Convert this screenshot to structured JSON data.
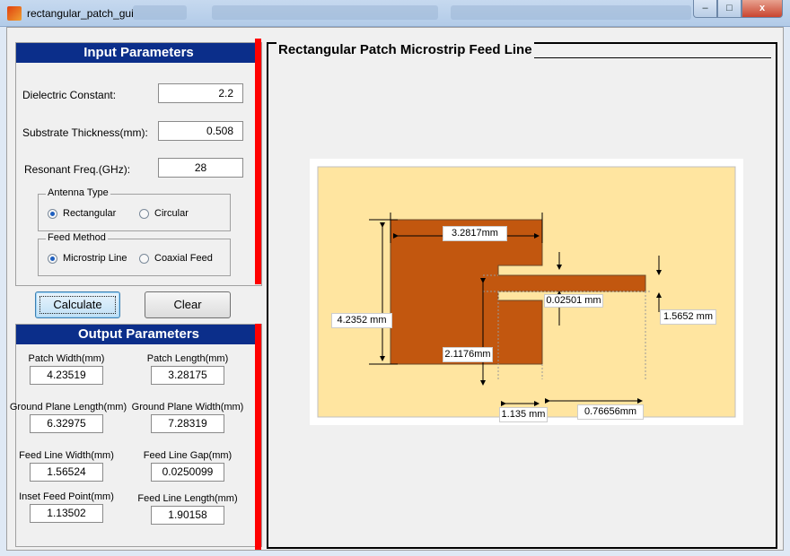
{
  "window": {
    "title": "rectangular_patch_gui",
    "minimize": "–",
    "maximize": "□",
    "close": "x"
  },
  "input": {
    "title": "Input Parameters",
    "dielectric_label": "Dielectric Constant:",
    "dielectric_value": "2.2",
    "thickness_label": "Substrate Thickness(mm):",
    "thickness_value": "0.508",
    "freq_label": "Resonant Freq.(GHz):",
    "freq_value": "28",
    "antenna_type": {
      "title": "Antenna Type",
      "options": [
        "Rectangular",
        "Circular"
      ],
      "selected": "Rectangular"
    },
    "feed_method": {
      "title": "Feed Method",
      "options": [
        "Microstrip Line",
        "Coaxial Feed"
      ],
      "selected": "Microstrip Line"
    }
  },
  "buttons": {
    "calculate": "Calculate",
    "clear": "Clear"
  },
  "output": {
    "title": "Output Parameters",
    "fields": [
      {
        "label": "Patch Width(mm)",
        "value": "4.23519"
      },
      {
        "label": "Patch Length(mm)",
        "value": "3.28175"
      },
      {
        "label": "Ground Plane Length(mm)",
        "value": "6.32975"
      },
      {
        "label": "Ground Plane Width(mm)",
        "value": "7.28319"
      },
      {
        "label": "Feed Line Width(mm)",
        "value": "1.56524"
      },
      {
        "label": "Feed Line Gap(mm)",
        "value": "0.0250099"
      },
      {
        "label": "Inset Feed Point(mm)",
        "value": "1.13502"
      },
      {
        "label": "Feed Line Length(mm)",
        "value": "1.90158"
      }
    ]
  },
  "plot": {
    "title": "Rectangular Patch Microstrip Feed Line",
    "colors": {
      "ground": "#ffe5a0",
      "patch": "#c2570f",
      "outline": "#555555"
    },
    "dims": {
      "length": "3.2817mm",
      "width": "4.2352 mm",
      "gap": "0.02501 mm",
      "feed_width": "1.5652 mm",
      "inset": "2.1176mm",
      "inset_point": "1.135 mm",
      "feed_length": "0.76656mm"
    }
  }
}
